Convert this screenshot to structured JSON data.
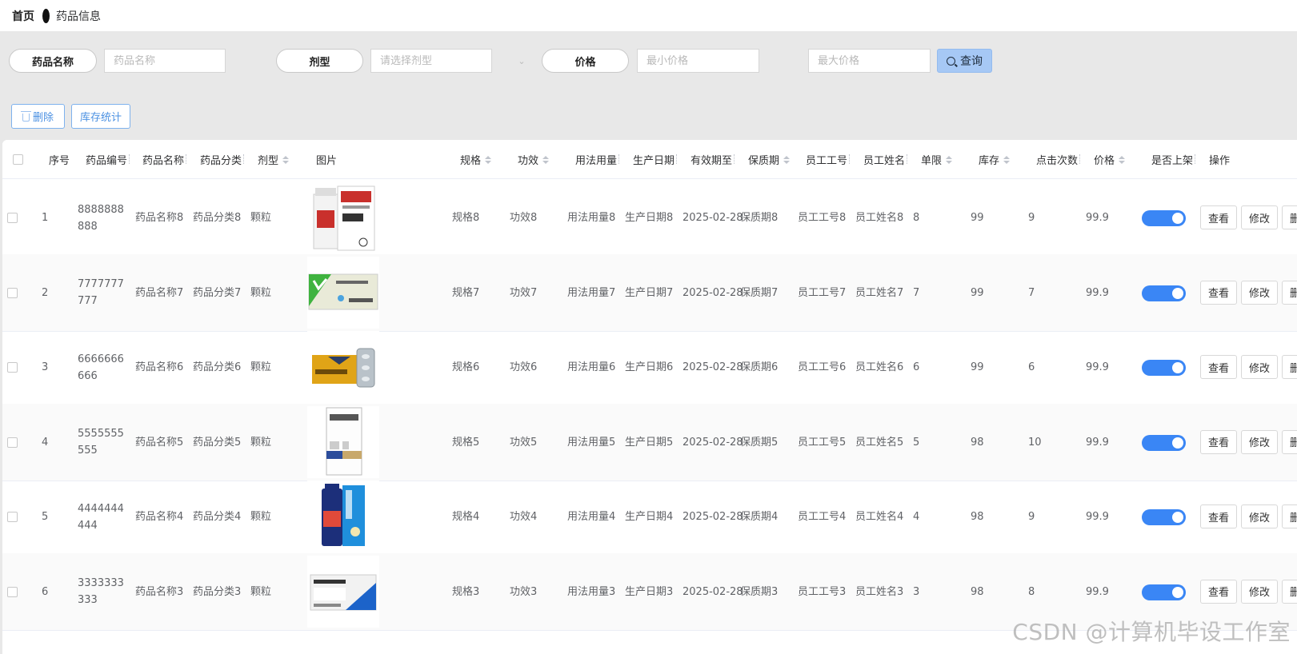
{
  "breadcrumb": {
    "home": "首页",
    "current": "药品信息"
  },
  "search": {
    "name_label": "药品名称",
    "name_placeholder": "药品名称",
    "form_label": "剂型",
    "form_placeholder": "请选择剂型",
    "price_label": "价格",
    "min_price_placeholder": "最小价格",
    "max_price_placeholder": "最大价格",
    "query_label": "查询"
  },
  "actions": {
    "delete_label": "删除",
    "stock_stats_label": "库存统计"
  },
  "table": {
    "headers": {
      "index": "序号",
      "code": "药品编号",
      "name": "药品名称",
      "category": "药品分类",
      "form": "剂型",
      "image": "图片",
      "spec": "规格",
      "effect": "功效",
      "usage": "用法用量",
      "produce_date": "生产日期",
      "expire_date": "有效期至",
      "shelf_life": "保质期",
      "staff_id": "员工工号",
      "staff_name": "员工姓名",
      "limit": "单限",
      "stock": "库存",
      "clicks": "点击次数",
      "price": "价格",
      "on_shelf": "是否上架",
      "ops": "操作"
    },
    "row_buttons": {
      "view": "查看",
      "edit": "修改",
      "delete": "删除"
    },
    "rows": [
      {
        "index": "1",
        "code": "8888888888",
        "name": "药品名称8",
        "category": "药品分类8",
        "form": "颗粒",
        "spec": "规格8",
        "effect": "功效8",
        "usage": "用法用量8",
        "produce_date": "生产日期8",
        "expire_date": "2025-02-28",
        "shelf_life": "保质期8",
        "staff_id": "员工工号8",
        "staff_name": "员工姓名8",
        "limit": "8",
        "stock": "99",
        "clicks": "9",
        "price": "99.9",
        "on_shelf": true
      },
      {
        "index": "2",
        "code": "7777777777",
        "name": "药品名称7",
        "category": "药品分类7",
        "form": "颗粒",
        "spec": "规格7",
        "effect": "功效7",
        "usage": "用法用量7",
        "produce_date": "生产日期7",
        "expire_date": "2025-02-28",
        "shelf_life": "保质期7",
        "staff_id": "员工工号7",
        "staff_name": "员工姓名7",
        "limit": "7",
        "stock": "99",
        "clicks": "7",
        "price": "99.9",
        "on_shelf": true
      },
      {
        "index": "3",
        "code": "6666666666",
        "name": "药品名称6",
        "category": "药品分类6",
        "form": "颗粒",
        "spec": "规格6",
        "effect": "功效6",
        "usage": "用法用量6",
        "produce_date": "生产日期6",
        "expire_date": "2025-02-28",
        "shelf_life": "保质期6",
        "staff_id": "员工工号6",
        "staff_name": "员工姓名6",
        "limit": "6",
        "stock": "99",
        "clicks": "6",
        "price": "99.9",
        "on_shelf": true
      },
      {
        "index": "4",
        "code": "5555555555",
        "name": "药品名称5",
        "category": "药品分类5",
        "form": "颗粒",
        "spec": "规格5",
        "effect": "功效5",
        "usage": "用法用量5",
        "produce_date": "生产日期5",
        "expire_date": "2025-02-28",
        "shelf_life": "保质期5",
        "staff_id": "员工工号5",
        "staff_name": "员工姓名5",
        "limit": "5",
        "stock": "98",
        "clicks": "10",
        "price": "99.9",
        "on_shelf": true
      },
      {
        "index": "5",
        "code": "4444444444",
        "name": "药品名称4",
        "category": "药品分类4",
        "form": "颗粒",
        "spec": "规格4",
        "effect": "功效4",
        "usage": "用法用量4",
        "produce_date": "生产日期4",
        "expire_date": "2025-02-28",
        "shelf_life": "保质期4",
        "staff_id": "员工工号4",
        "staff_name": "员工姓名4",
        "limit": "4",
        "stock": "98",
        "clicks": "9",
        "price": "99.9",
        "on_shelf": true
      },
      {
        "index": "6",
        "code": "3333333333",
        "name": "药品名称3",
        "category": "药品分类3",
        "form": "颗粒",
        "spec": "规格3",
        "effect": "功效3",
        "usage": "用法用量3",
        "produce_date": "生产日期3",
        "expire_date": "2025-02-28",
        "shelf_life": "保质期3",
        "staff_id": "员工工号3",
        "staff_name": "员工姓名3",
        "limit": "3",
        "stock": "98",
        "clicks": "8",
        "price": "99.9",
        "on_shelf": true
      }
    ]
  },
  "watermark": "CSDN @计算机毕设工作室"
}
